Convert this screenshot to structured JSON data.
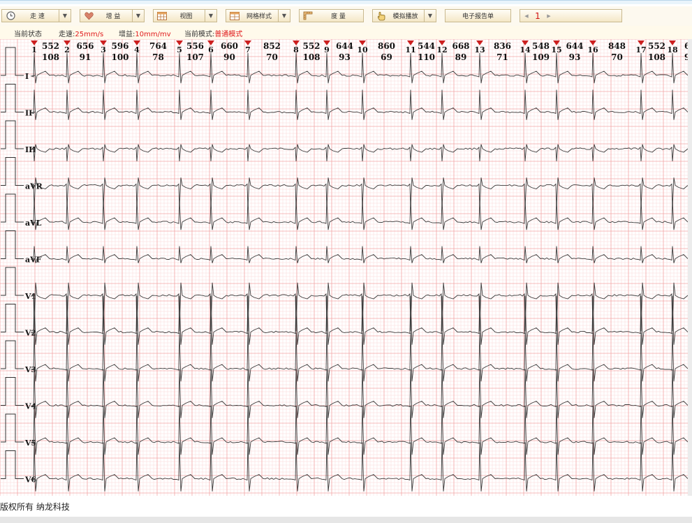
{
  "toolbar": {
    "speed_label": "走 速",
    "gain_label": "增 益",
    "view_label": "视图",
    "grid_style_label": "网格样式",
    "measure_label": "度 量",
    "playback_label": "模拟播放",
    "report_label": "电子报告单",
    "page_number": "1",
    "prev_glyph": "◀",
    "next_glyph": "▶"
  },
  "status": {
    "state_label": "当前状态",
    "speed_label": "走速:",
    "speed_value": "25mm/s",
    "gain_label": "增益:",
    "gain_value": "10mm/mv",
    "mode_label": "当前模式:",
    "mode_value": "普通模式"
  },
  "beats": [
    {
      "num": "1",
      "rr": "552",
      "hr": "108"
    },
    {
      "num": "2",
      "rr": "656",
      "hr": "91"
    },
    {
      "num": "3",
      "rr": "596",
      "hr": "100"
    },
    {
      "num": "4",
      "rr": "764",
      "hr": "78"
    },
    {
      "num": "5",
      "rr": "556",
      "hr": "107"
    },
    {
      "num": "6",
      "rr": "660",
      "hr": "90"
    },
    {
      "num": "7",
      "rr": "852",
      "hr": "70"
    },
    {
      "num": "8",
      "rr": "552",
      "hr": "108"
    },
    {
      "num": "9",
      "rr": "644",
      "hr": "93"
    },
    {
      "num": "10",
      "rr": "860",
      "hr": "69"
    },
    {
      "num": "11",
      "rr": "544",
      "hr": "110"
    },
    {
      "num": "12",
      "rr": "668",
      "hr": "89"
    },
    {
      "num": "13",
      "rr": "836",
      "hr": "71"
    },
    {
      "num": "14",
      "rr": "548",
      "hr": "109"
    },
    {
      "num": "15",
      "rr": "644",
      "hr": "93"
    },
    {
      "num": "16",
      "rr": "848",
      "hr": "70"
    },
    {
      "num": "17",
      "rr": "552",
      "hr": "108"
    },
    {
      "num": "18",
      "rr": "6",
      "hr": "9"
    }
  ],
  "leads": [
    {
      "name": "I",
      "polarity": "up",
      "amplitude": "medium"
    },
    {
      "name": "II",
      "polarity": "up",
      "amplitude": "medium"
    },
    {
      "name": "III",
      "polarity": "down",
      "amplitude": "small"
    },
    {
      "name": "aVR",
      "polarity": "down",
      "amplitude": "medium"
    },
    {
      "name": "aVL",
      "polarity": "up",
      "amplitude": "medium"
    },
    {
      "name": "aVF",
      "polarity": "up",
      "amplitude": "small"
    },
    {
      "name": "V1",
      "polarity": "down",
      "amplitude": "large"
    },
    {
      "name": "V2",
      "polarity": "up",
      "amplitude": "large"
    },
    {
      "name": "V3",
      "polarity": "up",
      "amplitude": "large"
    },
    {
      "name": "V4",
      "polarity": "up",
      "amplitude": "large"
    },
    {
      "name": "V5",
      "polarity": "up",
      "amplitude": "large"
    },
    {
      "name": "V6",
      "polarity": "up",
      "amplitude": "large"
    }
  ],
  "colors": {
    "grid_minor": "#fbd7d7",
    "grid_major": "#f3a6a6",
    "trace": "#3a3a3a",
    "marker": "#cc1f1f",
    "highlight_text": "#e0191b"
  },
  "footer": {
    "copyright": "版权所有 纳龙科技"
  }
}
